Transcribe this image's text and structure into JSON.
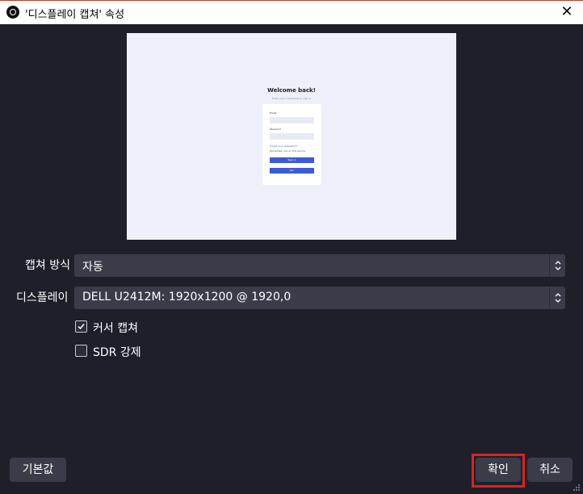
{
  "window": {
    "title": "'디스플레이 캡쳐' 속성",
    "close_symbol": "✕"
  },
  "preview": {
    "heading": "Welcome back!",
    "subheading": "Enter your credentials to sign in",
    "fields": [
      {
        "label": "Email",
        "placeholder": "name@example.com"
      },
      {
        "label": "Password",
        "placeholder": "••••••••"
      }
    ],
    "forgot_link": "Forgot your password?",
    "remember_text": "Remember me on this device",
    "sign_in_button": "Sign in",
    "second_button": "Join"
  },
  "form": {
    "capture_method": {
      "label": "캡쳐 방식",
      "value": "자동"
    },
    "display": {
      "label": "디스플레이",
      "value": "DELL U2412M: 1920x1200 @ 1920,0"
    },
    "capture_cursor": {
      "label": "커서 캡쳐",
      "checked": true
    },
    "force_sdr": {
      "label": "SDR 강제",
      "checked": false
    }
  },
  "buttons": {
    "defaults": "기본값",
    "ok": "확인",
    "cancel": "취소"
  },
  "colors": {
    "background": "#1e1f29",
    "control": "#3a3c4a",
    "accent_blue": "#3c5bd6",
    "highlight_red": "#e02020"
  }
}
